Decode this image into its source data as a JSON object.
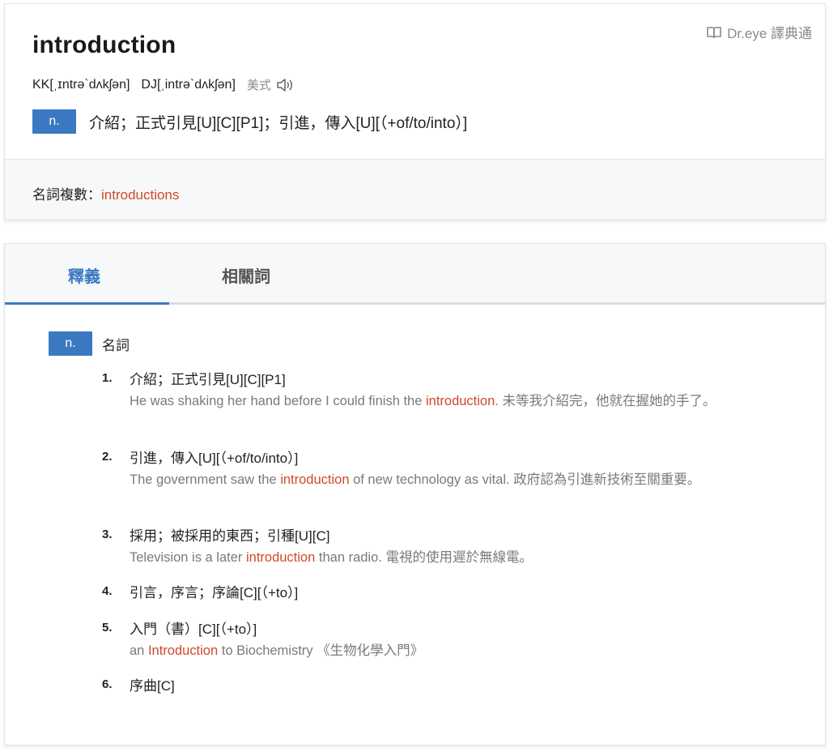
{
  "header": {
    "word": "introduction",
    "brand": "Dr.eye 譯典通",
    "kk": "KK[ˌɪntrə`dʌkʃən]",
    "dj": "DJ[ˌintrə`dʌkʃən]",
    "accent": "美式",
    "pos": "n.",
    "summary": "介紹；正式引見[U][C][P1]；引進，傳入[U][（+of/to/into）]",
    "plural_label": "名詞複數：",
    "plural": "introductions"
  },
  "tabs": [
    {
      "label": "釋義",
      "active": true
    },
    {
      "label": "相關詞",
      "active": false
    }
  ],
  "entry": {
    "pos": "n.",
    "pos_name": "名詞",
    "senses": [
      {
        "num": "1.",
        "gloss": "介紹；正式引見[U][C][P1]",
        "ex_before": "He was shaking her hand before I could finish the ",
        "ex_hl": "introduction",
        "ex_after": ". 未等我介紹完，他就在握她的手了。"
      },
      {
        "num": "2.",
        "gloss": "引進，傳入[U][（+of/to/into）]",
        "ex_before": "The government saw the ",
        "ex_hl": "introduction",
        "ex_after": " of new technology as vital. 政府認為引進新技術至關重要。"
      },
      {
        "num": "3.",
        "gloss": "採用；被採用的東西；引種[U][C]",
        "ex_before": "Television is a later ",
        "ex_hl": "introduction",
        "ex_after": " than radio. 電視的使用遲於無線電。"
      },
      {
        "num": "4.",
        "gloss": "引言，序言；序論[C][（+to）]",
        "ex_before": "",
        "ex_hl": "",
        "ex_after": ""
      },
      {
        "num": "5.",
        "gloss": "入門（書）[C][（+to）]",
        "ex_before": "an ",
        "ex_hl": "Introduction",
        "ex_after": " to Biochemistry 《生物化學入門》"
      },
      {
        "num": "6.",
        "gloss": "序曲[C]",
        "ex_before": "",
        "ex_hl": "",
        "ex_after": ""
      }
    ]
  },
  "colors": {
    "accent_blue": "#3b78c2",
    "highlight_red": "#d0492a",
    "muted_gray": "#7a7a7a"
  }
}
